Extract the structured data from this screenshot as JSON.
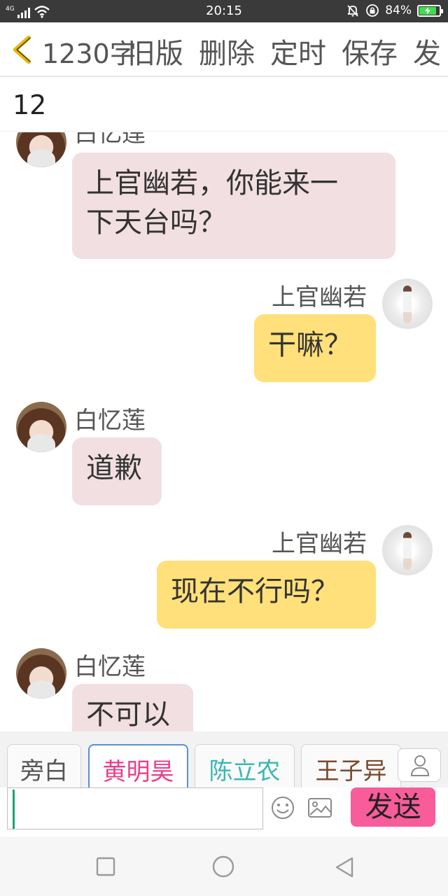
{
  "status_bar": {
    "network": "4G",
    "time": "20:15",
    "battery": "84%",
    "icons": [
      "signal-icon",
      "wifi-icon",
      "mute-icon",
      "rotation-lock-icon",
      "battery-icon"
    ]
  },
  "toolbar": {
    "back_icon": "chevron-left-icon",
    "word_count": "1230字",
    "old_version": "旧版",
    "delete": "删除",
    "schedule": "定时",
    "save": "保存",
    "publish": "发"
  },
  "chapter": {
    "title": "12"
  },
  "messages": [
    {
      "speaker": "白忆莲",
      "side": "left",
      "avatar": "bai-yilian-avatar",
      "text_lines": [
        "上官幽若，你能来一",
        "下天台吗？"
      ]
    },
    {
      "speaker": "上官幽若",
      "side": "right",
      "avatar": "shangguan-youruo-avatar",
      "text_lines": [
        "干嘛？"
      ]
    },
    {
      "speaker": "白忆莲",
      "side": "left",
      "avatar": "bai-yilian-avatar",
      "text_lines": [
        "道歉"
      ]
    },
    {
      "speaker": "上官幽若",
      "side": "right",
      "avatar": "shangguan-youruo-avatar",
      "text_lines": [
        "现在不行吗？"
      ]
    },
    {
      "speaker": "白忆莲",
      "side": "left",
      "avatar": "bai-yilian-avatar",
      "text_lines": [
        "不可以"
      ]
    }
  ],
  "roles": {
    "items": [
      {
        "label": "旁白",
        "color": "#555555",
        "selected": false
      },
      {
        "label": "黄明昊",
        "color": "#e8408a",
        "selected": true
      },
      {
        "label": "陈立农",
        "color": "#3bb6b4",
        "selected": false
      },
      {
        "label": "王子异",
        "color": "#7a4a2e",
        "selected": false
      }
    ],
    "add_icon": "person-icon"
  },
  "composer": {
    "input_value": "",
    "emoji_icon": "smiley-icon",
    "image_icon": "image-icon",
    "send_label": "发送",
    "send_color": "#f85c9a"
  },
  "nav": {
    "icons": [
      "recent-apps-icon",
      "home-icon",
      "back-icon"
    ]
  },
  "colors": {
    "accent": "#f0c000",
    "bubble_left": "#f2dfe1",
    "bubble_right": "#ffe07a"
  }
}
